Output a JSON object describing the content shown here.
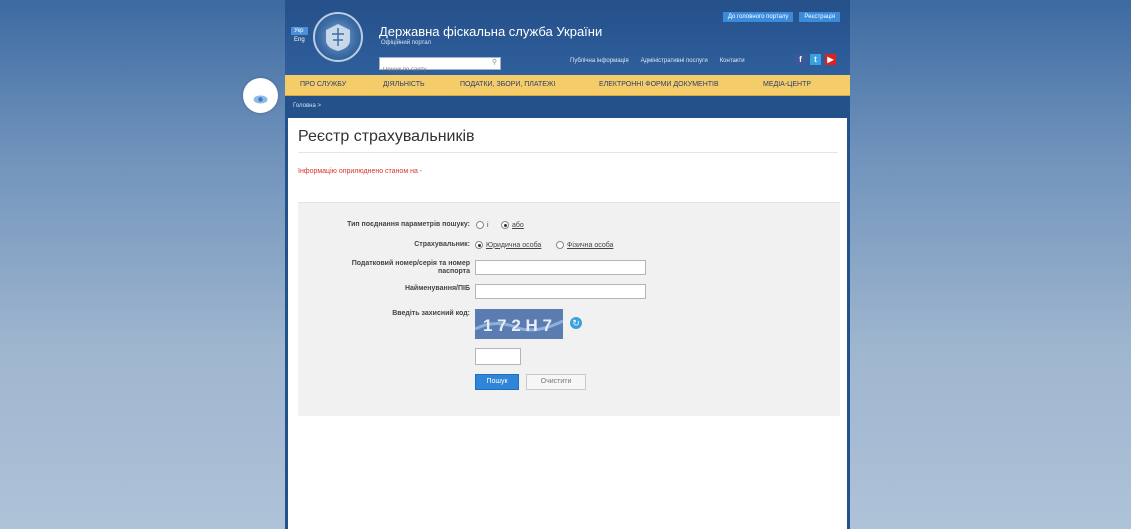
{
  "header": {
    "lang_active": "Укр",
    "lang_other": "Eng",
    "site_title": "Державна фіскальна служба України",
    "site_subtitle": "Офіційний портал",
    "search_placeholder": "Пошук по сайту",
    "top_links": [
      "До головного порталу",
      "Реєстрація"
    ],
    "nav_links": [
      "Публічна інформація",
      "Адміністративні послуги",
      "Контакти"
    ],
    "social": [
      "facebook-icon",
      "twitter-icon",
      "youtube-icon"
    ]
  },
  "menu": [
    "ПРО СЛУЖБУ",
    "ДІЯЛЬНІСТЬ",
    "ПОДАТКИ, ЗБОРИ, ПЛАТЕЖІ",
    "ЕЛЕКТРОННІ ФОРМИ ДОКУМЕНТІВ",
    "МЕДІА-ЦЕНТР"
  ],
  "breadcrumb": "Головна >",
  "page": {
    "title": "Реєстр страхувальників",
    "info": "Інформацію оприлюднено станом на -"
  },
  "form": {
    "combo_label": "Тип поєднання параметрів пошуку:",
    "combo_and": "і",
    "combo_or": "або",
    "insurer_label": "Страхувальник:",
    "insurer_legal": "Юридична особа",
    "insurer_physical": "Фізична особа",
    "tax_label_1": "Податковий номер/серія та номер",
    "tax_label_2": "паспорта",
    "name_label": "Найменування/ПІБ",
    "captcha_label": "Введіть захисний код:",
    "captcha_text": "1 7 2 H 7",
    "search_btn": "Пошук",
    "clear_btn": "Очистити"
  },
  "colors": {
    "header_bg": "#25508a",
    "menu_bg": "#f4cc6a",
    "accent": "#2f86d8",
    "info_red": "#d9342b"
  }
}
